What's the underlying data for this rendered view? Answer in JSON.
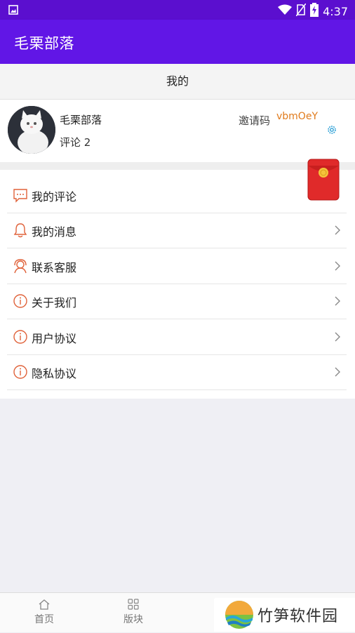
{
  "status_bar": {
    "time": "4:37"
  },
  "app_bar": {
    "title": "毛栗部落"
  },
  "page_header": {
    "title": "我的"
  },
  "profile": {
    "username": "毛栗部落",
    "comments": "评论 2",
    "invite_label": "邀请码",
    "invite_code": "vbmOeY"
  },
  "menu": {
    "items": [
      {
        "label": "我的评论",
        "icon": "comment-icon"
      },
      {
        "label": "我的消息",
        "icon": "bell-icon"
      },
      {
        "label": "联系客服",
        "icon": "support-agent-icon"
      },
      {
        "label": "关于我们",
        "icon": "info-icon"
      },
      {
        "label": "用户协议",
        "icon": "info-icon"
      },
      {
        "label": "隐私协议",
        "icon": "info-icon"
      }
    ]
  },
  "tabs": [
    {
      "label": "首页",
      "icon": "home-icon"
    },
    {
      "label": "版块",
      "icon": "grid-icon"
    },
    {
      "label": "",
      "icon": ""
    }
  ],
  "watermark": {
    "text": "竹笋软件园"
  },
  "colors": {
    "status_bar": "#5b0fcf",
    "app_bar": "#6116e6",
    "accent_icon": "#e0623a",
    "invite_code": "#e07a1b",
    "red_packet": "#e02a2a"
  }
}
